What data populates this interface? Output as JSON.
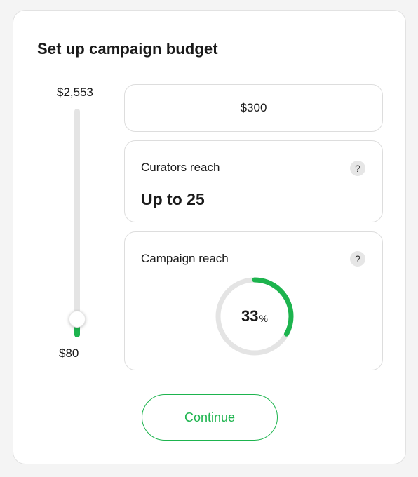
{
  "title": "Set up campaign budget",
  "slider": {
    "max_label": "$2,553",
    "min_label": "$80",
    "value_fraction": 0.03
  },
  "budget": {
    "amount": "$300"
  },
  "curators": {
    "label": "Curators reach",
    "value": "Up to 25",
    "help_icon": "?"
  },
  "campaign": {
    "label": "Campaign reach",
    "help_icon": "?",
    "percent": 33,
    "percent_text": "33",
    "unit": "%"
  },
  "continue_label": "Continue",
  "colors": {
    "accent": "#1db44e",
    "track": "#e4e4e4"
  }
}
